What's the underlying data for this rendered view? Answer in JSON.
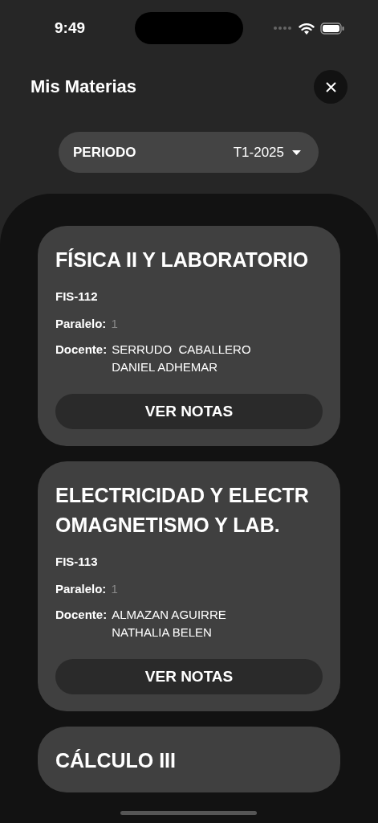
{
  "status_bar": {
    "time": "9:49"
  },
  "header": {
    "title": "Mis Materias"
  },
  "period": {
    "label": "PERIODO",
    "value": "T1-2025"
  },
  "subjects": [
    {
      "title": "FÍSICA II Y LABORATORIO",
      "code": "FIS-112",
      "parallel_label": "Paralelo:",
      "parallel": "1",
      "teacher_label": "Docente:",
      "teacher": "SERRUDO  CABALLERO DANIEL ADHEMAR",
      "button": "VER NOTAS"
    },
    {
      "title": "ELECTRICIDAD Y ELECTROMAGNETISMO Y LAB.",
      "code": "FIS-113",
      "parallel_label": "Paralelo:",
      "parallel": "1",
      "teacher_label": "Docente:",
      "teacher": "ALMAZAN AGUIRRE NATHALIA BELEN",
      "button": "VER NOTAS"
    },
    {
      "title": "CÁLCULO III"
    }
  ]
}
